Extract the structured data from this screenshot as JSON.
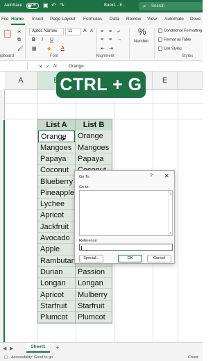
{
  "window": {
    "autosave_label": "AutoSave",
    "autosave_state": "Off",
    "book_title": "Book1 - E...",
    "search_placeholder": "Search"
  },
  "menu": {
    "tabs": [
      "File",
      "Home",
      "Insert",
      "Page Layout",
      "Formulas",
      "Data",
      "Review",
      "View",
      "Automate",
      "Deve"
    ],
    "active": "Home"
  },
  "ribbon": {
    "font_name": "Aptos Narrow",
    "font_size": "11",
    "number_format_label": "Number",
    "groups": {
      "clipboard": "ipboard",
      "font": "Font",
      "alignment": "Alignment",
      "styles": "Styles"
    },
    "styles_items": [
      "Conditional Formatting",
      "Format as Table",
      "Cell Styles"
    ]
  },
  "formula_bar": {
    "fx": "fx",
    "content": "Orange"
  },
  "grid": {
    "columns": [
      "A",
      "B",
      "C",
      "D",
      "E"
    ],
    "selected_column": "B"
  },
  "table": {
    "headers": [
      "List A",
      "List B"
    ],
    "rows": [
      [
        "Orange",
        "Orange"
      ],
      [
        "Mangoes",
        "Mangoes"
      ],
      [
        "Papaya",
        "Papaya"
      ],
      [
        "Coconut",
        "Coconut"
      ],
      [
        "Blueberry",
        ""
      ],
      [
        "Pineapple",
        ""
      ],
      [
        "Lychee",
        ""
      ],
      [
        "Apricot",
        ""
      ],
      [
        "Jackfruit",
        ""
      ],
      [
        "Avocado",
        ""
      ],
      [
        "Apple",
        ""
      ],
      [
        "Rambutan",
        ""
      ],
      [
        "Durian",
        "Passion"
      ],
      [
        "Longan",
        "Longan"
      ],
      [
        "Apricot",
        "Mulberry"
      ],
      [
        "Starfruit",
        "Starfruit"
      ],
      [
        "Plumcot",
        "Plumcot"
      ]
    ]
  },
  "overlay": {
    "shortcut_text": "CTRL + G"
  },
  "goto_dialog": {
    "title": "Go To",
    "help": "?",
    "close": "✕",
    "goto_label": "Go to:",
    "reference_label": "Reference:",
    "reference_value": "",
    "special_button": "Special...",
    "ok_button": "OK",
    "cancel_button": "Cancel"
  },
  "sheets": {
    "active_tab": "Sheet1",
    "add": "+"
  },
  "status": {
    "accessibility": "Accessibility: Good to go",
    "right_text": "Count"
  },
  "colors": {
    "excel_green": "#1e7145",
    "table_fill": "#dfe9e1",
    "header_fill": "#c6d9cc"
  }
}
